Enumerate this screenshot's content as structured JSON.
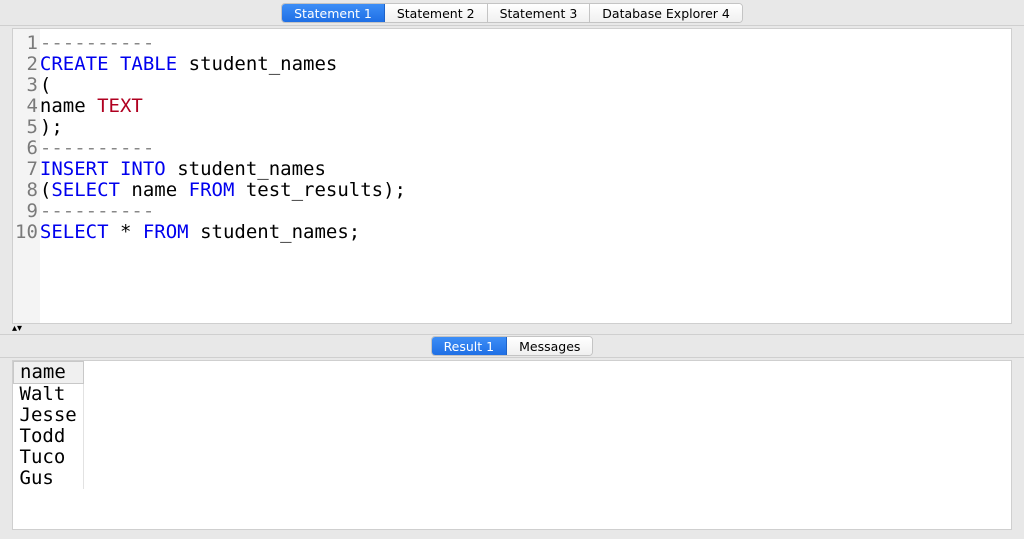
{
  "top_tabs": {
    "items": [
      {
        "label": "Statement 1",
        "active": true
      },
      {
        "label": "Statement 2",
        "active": false
      },
      {
        "label": "Statement 3",
        "active": false
      },
      {
        "label": "Database Explorer 4",
        "active": false
      }
    ]
  },
  "editor": {
    "lines": [
      {
        "n": 1,
        "tokens": [
          {
            "t": "----------",
            "c": "comment"
          }
        ]
      },
      {
        "n": 2,
        "tokens": [
          {
            "t": "CREATE",
            "c": "kw"
          },
          {
            "t": " "
          },
          {
            "t": "TABLE",
            "c": "kw"
          },
          {
            "t": " student_names"
          }
        ]
      },
      {
        "n": 3,
        "tokens": [
          {
            "t": "("
          }
        ]
      },
      {
        "n": 4,
        "tokens": [
          {
            "t": "name "
          },
          {
            "t": "TEXT",
            "c": "type"
          }
        ]
      },
      {
        "n": 5,
        "tokens": [
          {
            "t": ");"
          }
        ]
      },
      {
        "n": 6,
        "tokens": [
          {
            "t": "----------",
            "c": "comment"
          }
        ]
      },
      {
        "n": 7,
        "tokens": [
          {
            "t": "INSERT",
            "c": "kw"
          },
          {
            "t": " "
          },
          {
            "t": "INTO",
            "c": "kw"
          },
          {
            "t": " student_names"
          }
        ]
      },
      {
        "n": 8,
        "tokens": [
          {
            "t": "("
          },
          {
            "t": "SELECT",
            "c": "kw"
          },
          {
            "t": " name "
          },
          {
            "t": "FROM",
            "c": "kw"
          },
          {
            "t": " test_results);"
          }
        ]
      },
      {
        "n": 9,
        "tokens": [
          {
            "t": "----------",
            "c": "comment"
          }
        ]
      },
      {
        "n": 10,
        "tokens": [
          {
            "t": "SELECT",
            "c": "kw"
          },
          {
            "t": " * "
          },
          {
            "t": "FROM",
            "c": "kw"
          },
          {
            "t": " student_names;"
          }
        ]
      }
    ]
  },
  "splitter_glyph": "▴▾",
  "bottom_tabs": {
    "items": [
      {
        "label": "Result 1",
        "active": true
      },
      {
        "label": "Messages",
        "active": false
      }
    ]
  },
  "result": {
    "columns": [
      "name"
    ],
    "rows": [
      [
        "Walt"
      ],
      [
        "Jesse"
      ],
      [
        "Todd"
      ],
      [
        "Tuco"
      ],
      [
        "Gus"
      ]
    ]
  }
}
